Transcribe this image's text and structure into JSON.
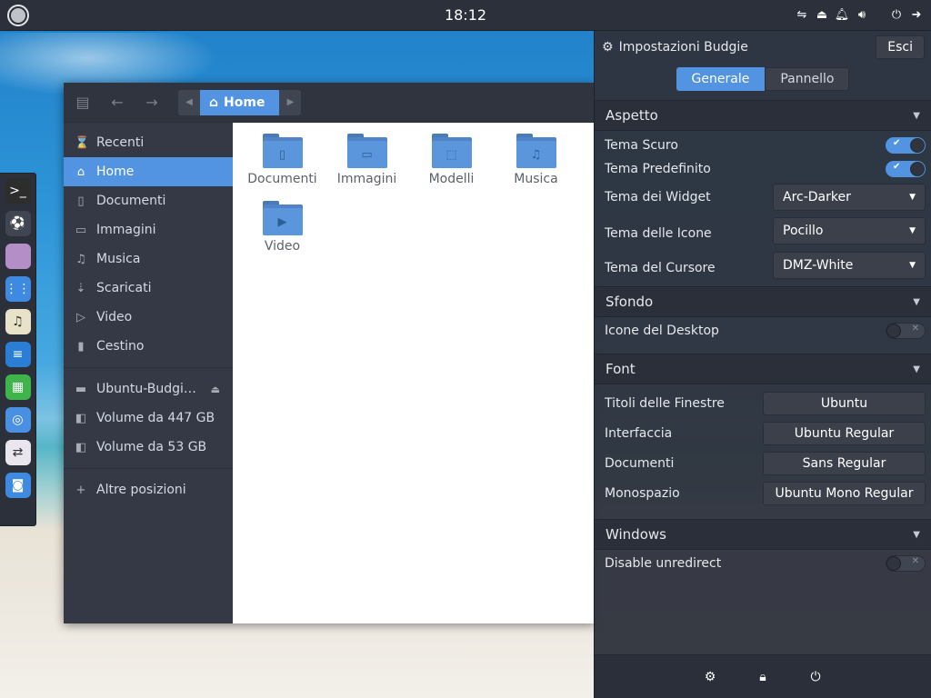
{
  "top_panel": {
    "clock": "18:12"
  },
  "dock": {
    "apps": [
      {
        "icon": "terminal-icon",
        "label": ">_",
        "color": "#2d2d2d"
      },
      {
        "icon": "soccer-ball-icon",
        "label": "⚽",
        "color": "#404552"
      },
      {
        "icon": "files-icon",
        "label": "",
        "color": "#b48ec7"
      },
      {
        "icon": "app-grid-icon",
        "label": "⋮⋮",
        "color": "#3d8ae0"
      },
      {
        "icon": "music-icon",
        "label": "♫",
        "color": "#e8e2c8"
      },
      {
        "icon": "writer-icon",
        "label": "≡",
        "color": "#2b7ed6"
      },
      {
        "icon": "calc-icon",
        "label": "▦",
        "color": "#3fb44b"
      },
      {
        "icon": "chrome-icon",
        "label": "◎",
        "color": "#4a90e2"
      },
      {
        "icon": "settings-toggles-icon",
        "label": "⇄",
        "color": "#e9e6ee"
      },
      {
        "icon": "screenshot-icon",
        "label": "◙",
        "color": "#3d8ae0"
      }
    ]
  },
  "files": {
    "path": {
      "current": "Home"
    },
    "sidebar": {
      "places": [
        {
          "label": "Recenti",
          "icon": "clock-icon",
          "glyph": "⌛"
        },
        {
          "label": "Home",
          "icon": "home-icon",
          "glyph": "⌂",
          "active": true
        },
        {
          "label": "Documenti",
          "icon": "document-icon",
          "glyph": "▯"
        },
        {
          "label": "Immagini",
          "icon": "image-icon",
          "glyph": "▭"
        },
        {
          "label": "Musica",
          "icon": "music-note-icon",
          "glyph": "♫"
        },
        {
          "label": "Scaricati",
          "icon": "download-icon",
          "glyph": "⇣"
        },
        {
          "label": "Video",
          "icon": "video-icon",
          "glyph": "▷"
        },
        {
          "label": "Cestino",
          "icon": "trash-icon",
          "glyph": "▮"
        }
      ],
      "devices": [
        {
          "label": "Ubuntu-Budgi…",
          "icon": "drive-icon",
          "glyph": "▬",
          "eject": true
        },
        {
          "label": "Volume da 447 GB",
          "icon": "disk-icon",
          "glyph": "◧"
        },
        {
          "label": "Volume da 53 GB",
          "icon": "disk-icon",
          "glyph": "◧"
        }
      ],
      "other": {
        "label": "Altre posizioni",
        "glyph": "+"
      }
    },
    "items": [
      {
        "name": "Documenti",
        "emblem": "▯"
      },
      {
        "name": "Immagini",
        "emblem": "▭"
      },
      {
        "name": "Modelli",
        "emblem": "⬚"
      },
      {
        "name": "Musica",
        "emblem": "♫"
      },
      {
        "name": "Video",
        "emblem": "▶"
      }
    ]
  },
  "raven": {
    "title": "Impostazioni Budgie",
    "close_label": "Esci",
    "tabs": [
      {
        "label": "Generale",
        "active": true
      },
      {
        "label": "Pannello",
        "active": false
      }
    ],
    "sections": {
      "aspetto": {
        "title": "Aspetto",
        "dark_theme": {
          "label": "Tema Scuro",
          "on": true
        },
        "default_theme": {
          "label": "Tema Predefinito",
          "on": true
        },
        "widget_theme": {
          "label": "Tema dei Widget",
          "value": "Arc-Darker"
        },
        "icon_theme": {
          "label": "Tema delle Icone",
          "value": "Pocillo"
        },
        "cursor_theme": {
          "label": "Tema del Cursore",
          "value": "DMZ-White"
        }
      },
      "sfondo": {
        "title": "Sfondo",
        "desktop_icons": {
          "label": "Icone del Desktop",
          "on": false
        }
      },
      "font": {
        "title": "Font",
        "rows": [
          {
            "label": "Titoli delle Finestre",
            "value": "Ubuntu"
          },
          {
            "label": "Interfaccia",
            "value": "Ubuntu Regular"
          },
          {
            "label": "Documenti",
            "value": "Sans Regular"
          },
          {
            "label": "Monospazio",
            "value": "Ubuntu Mono Regular"
          }
        ]
      },
      "windows": {
        "title": "Windows",
        "unredirect": {
          "label": "Disable unredirect",
          "on": false
        }
      }
    }
  }
}
